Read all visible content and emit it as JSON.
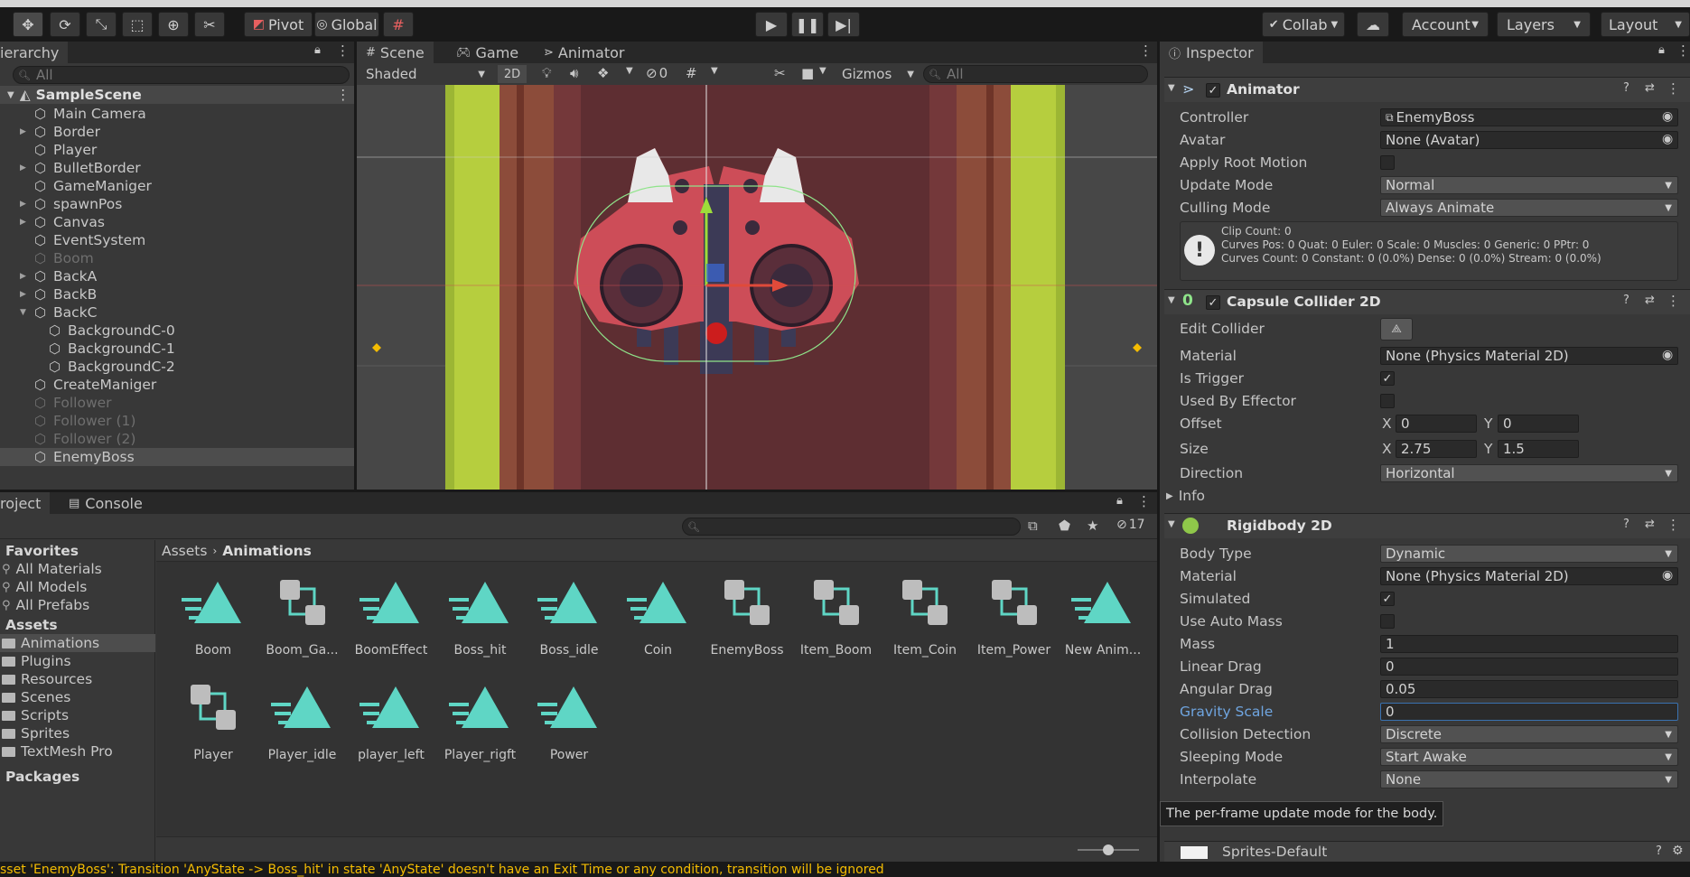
{
  "toolbar": {
    "pivot_label": "Pivot",
    "global_label": "Global",
    "collab_label": "Collab",
    "account_label": "Account",
    "layers_label": "Layers",
    "layout_label": "Layout"
  },
  "hierarchy": {
    "tab_label": "ierarchy",
    "search_placeholder": "All",
    "scene_name": "SampleScene",
    "items": [
      {
        "label": "Main Camera"
      },
      {
        "label": "Border"
      },
      {
        "label": "Player"
      },
      {
        "label": "BulletBorder"
      },
      {
        "label": "GameManiger"
      },
      {
        "label": "spawnPos"
      },
      {
        "label": "Canvas"
      },
      {
        "label": "EventSystem"
      },
      {
        "label": "Boom"
      },
      {
        "label": "BackA"
      },
      {
        "label": "BackB"
      },
      {
        "label": "BackC"
      },
      {
        "label": "BackgroundC-0"
      },
      {
        "label": "BackgroundC-1"
      },
      {
        "label": "BackgroundC-2"
      },
      {
        "label": "CreateManiger"
      },
      {
        "label": "Follower"
      },
      {
        "label": "Follower (1)"
      },
      {
        "label": "Follower (2)"
      },
      {
        "label": "EnemyBoss"
      }
    ]
  },
  "scene": {
    "tabs": [
      {
        "label": "Scene"
      },
      {
        "label": "Game"
      },
      {
        "label": "Animator"
      }
    ],
    "shading": "Shaded",
    "mode_2d": "2D",
    "hidden_count": "0",
    "gizmos_label": "Gizmos",
    "search_placeholder": "All"
  },
  "project": {
    "tabs": [
      {
        "label": "roject"
      },
      {
        "label": "Console"
      }
    ],
    "hidden_count": "17",
    "breadcrumb_root": "Assets",
    "breadcrumb_current": "Animations",
    "favorites_header": "Favorites",
    "favorites": [
      {
        "label": "All Materials"
      },
      {
        "label": "All Models"
      },
      {
        "label": "All Prefabs"
      }
    ],
    "assets_header": "Assets",
    "folders": [
      {
        "label": "Animations"
      },
      {
        "label": "Plugins"
      },
      {
        "label": "Resources"
      },
      {
        "label": "Scenes"
      },
      {
        "label": "Scripts"
      },
      {
        "label": "Sprites"
      },
      {
        "label": "TextMesh Pro"
      }
    ],
    "packages_header": "Packages",
    "assets": [
      {
        "label": "Boom",
        "kind": "clip"
      },
      {
        "label": "Boom_Ga...",
        "kind": "controller"
      },
      {
        "label": "BoomEffect",
        "kind": "clip"
      },
      {
        "label": "Boss_hit",
        "kind": "clip"
      },
      {
        "label": "Boss_idle",
        "kind": "clip"
      },
      {
        "label": "Coin",
        "kind": "clip"
      },
      {
        "label": "EnemyBoss",
        "kind": "controller"
      },
      {
        "label": "Item_Boom",
        "kind": "controller"
      },
      {
        "label": "Item_Coin",
        "kind": "controller"
      },
      {
        "label": "Item_Power",
        "kind": "controller"
      },
      {
        "label": "New Anim...",
        "kind": "clip"
      },
      {
        "label": "Player",
        "kind": "controller"
      },
      {
        "label": "Player_idle",
        "kind": "clip"
      },
      {
        "label": "player_left",
        "kind": "clip"
      },
      {
        "label": "Player_rigft",
        "kind": "clip"
      },
      {
        "label": "Power",
        "kind": "clip"
      }
    ]
  },
  "inspector": {
    "tab_label": "Inspector",
    "animator": {
      "title": "Animator",
      "controller_label": "Controller",
      "controller_value": "EnemyBoss",
      "avatar_label": "Avatar",
      "avatar_value": "None (Avatar)",
      "apply_root_label": "Apply Root Motion",
      "update_mode_label": "Update Mode",
      "update_mode_value": "Normal",
      "culling_label": "Culling Mode",
      "culling_value": "Always Animate",
      "info_line1": "Clip Count: 0",
      "info_line2": "Curves Pos: 0 Quat: 0 Euler: 0 Scale: 0 Muscles: 0 Generic: 0 PPtr: 0",
      "info_line3": "Curves Count: 0 Constant: 0 (0.0%) Dense: 0 (0.0%) Stream: 0 (0.0%)"
    },
    "capsule": {
      "title": "Capsule Collider 2D",
      "edit_collider_label": "Edit Collider",
      "material_label": "Material",
      "material_value": "None (Physics Material 2D)",
      "is_trigger_label": "Is Trigger",
      "used_by_effector_label": "Used By Effector",
      "offset_label": "Offset",
      "offset_x": "0",
      "offset_y": "0",
      "size_label": "Size",
      "size_x": "2.75",
      "size_y": "1.5",
      "x_label": "X",
      "y_label": "Y",
      "direction_label": "Direction",
      "direction_value": "Horizontal",
      "info_label": "Info"
    },
    "rigidbody": {
      "title": "Rigidbody 2D",
      "body_type_label": "Body Type",
      "body_type_value": "Dynamic",
      "material_label": "Material",
      "material_value": "None (Physics Material 2D)",
      "simulated_label": "Simulated",
      "use_auto_mass_label": "Use Auto Mass",
      "mass_label": "Mass",
      "mass_value": "1",
      "linear_drag_label": "Linear Drag",
      "linear_drag_value": "0",
      "angular_drag_label": "Angular Drag",
      "angular_drag_value": "0.05",
      "gravity_label": "Gravity Scale",
      "gravity_value": "0",
      "collision_label": "Collision Detection",
      "collision_value": "Discrete",
      "sleeping_label": "Sleeping Mode",
      "sleeping_value": "Start Awake",
      "interpolate_label": "Interpolate",
      "interpolate_value": "None"
    },
    "tooltip": "The per-frame update mode for the body.",
    "material_footer": "Sprites-Default"
  },
  "status_bar": {
    "message": "sset 'EnemyBoss': Transition 'AnyState -> Boss_hit' in state 'AnyState' doesn't have an Exit Time or any condition, transition will be ignored"
  },
  "colors": {
    "accent_blue": "#3a72b0",
    "selected_row": "#4d4d4d",
    "warning_yellow": "#f4bc02",
    "clip_icon": "#5fd6c5"
  }
}
